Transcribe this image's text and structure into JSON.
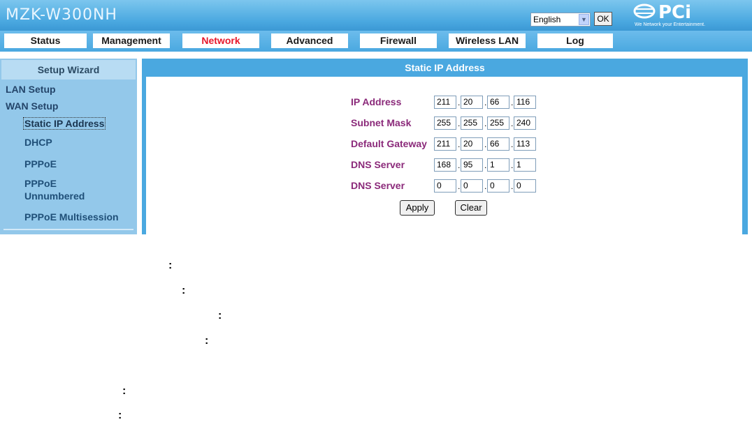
{
  "header": {
    "title": "MZK-W300NH",
    "language": "English",
    "ok_label": "OK",
    "logo_text": "PCi",
    "logo_tagline": "We Network your Entertainment."
  },
  "nav": {
    "tabs": [
      {
        "label": "Status"
      },
      {
        "label": "Management"
      },
      {
        "label": "Network"
      },
      {
        "label": "Advanced"
      },
      {
        "label": "Firewall"
      },
      {
        "label": "Wireless LAN"
      },
      {
        "label": "Log"
      }
    ],
    "active": "Network"
  },
  "sidebar": {
    "heading": "Setup Wizard",
    "items": [
      {
        "label": "LAN Setup"
      },
      {
        "label": "WAN Setup"
      },
      {
        "label": "Static IP Address"
      },
      {
        "label": "DHCP"
      },
      {
        "label": "PPPoE"
      },
      {
        "label": "PPPoE"
      },
      {
        "label": "Unnumbered"
      },
      {
        "label": "PPPoE Multisession"
      }
    ],
    "selected": "Static IP Address"
  },
  "content": {
    "title": "Static IP Address",
    "fields": [
      {
        "label": "IP Address",
        "octets": [
          "211",
          "20",
          "66",
          "116"
        ]
      },
      {
        "label": "Subnet Mask",
        "octets": [
          "255",
          "255",
          "255",
          "240"
        ]
      },
      {
        "label": "Default Gateway",
        "octets": [
          "211",
          "20",
          "66",
          "113"
        ]
      },
      {
        "label": "DNS Server",
        "octets": [
          "168",
          "95",
          "1",
          "1"
        ]
      },
      {
        "label": "DNS Server",
        "octets": [
          "0",
          "0",
          "0",
          "0"
        ]
      }
    ],
    "apply_label": "Apply",
    "clear_label": "Clear"
  },
  "annotations": {
    "colon": ":"
  },
  "colors": {
    "header_blue": "#4aa8e0",
    "active_tab_red": "#e8182b",
    "label_purple": "#8b2a7a"
  }
}
